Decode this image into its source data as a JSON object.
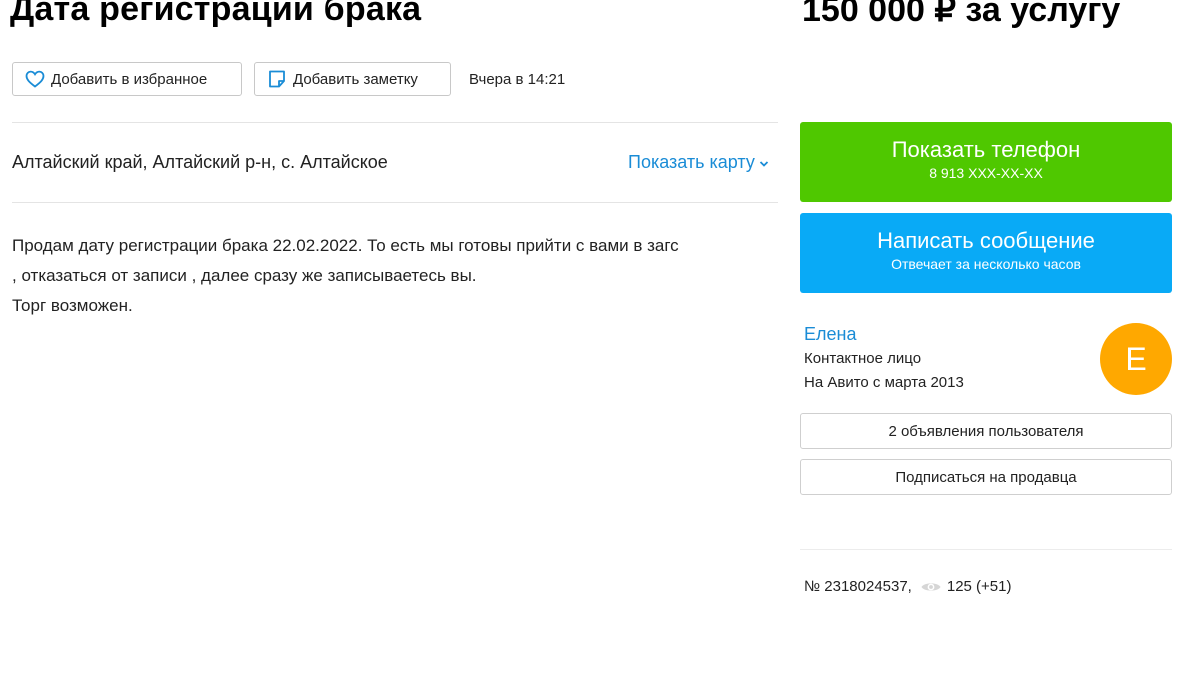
{
  "listing": {
    "title": "Дата регистрации брака",
    "price": "150 000 ₽ за услугу",
    "favorite_label": "Добавить в избранное",
    "note_label": "Добавить заметку",
    "posted": "Вчера в 14:21",
    "address": "Алтайский край, Алтайский р-н, с. Алтайское",
    "show_map_label": "Показать карту",
    "description": [
      "Продам дату регистрации брака 22.02.2022. То есть мы готовы прийти с вами в загс",
      ", отказаться от записи , далее сразу же записываетесь вы.",
      "Торг возможен."
    ]
  },
  "contact": {
    "phone_label": "Показать телефон",
    "phone_masked": "8 913 XXX-XX-XX",
    "message_label": "Написать сообщение",
    "message_sub": "Отвечает за несколько часов"
  },
  "seller": {
    "name": "Елена",
    "role": "Контактное лицо",
    "since": "На Авито с марта 2013",
    "avatar_letter": "Е",
    "ads_label": "2 объявления пользователя",
    "subscribe_label": "Подписаться на продавца"
  },
  "meta": {
    "number": "№ 2318024537,",
    "views": "125 (+51)"
  },
  "icons": {
    "favorite": "heart-icon",
    "note": "note-icon",
    "map": "chevron-down-icon",
    "views": "eye-icon"
  },
  "colors": {
    "link": "#1a8cd6",
    "phone_button": "#4fc800",
    "message_button": "#09aaf6",
    "avatar": "#ffa800"
  }
}
